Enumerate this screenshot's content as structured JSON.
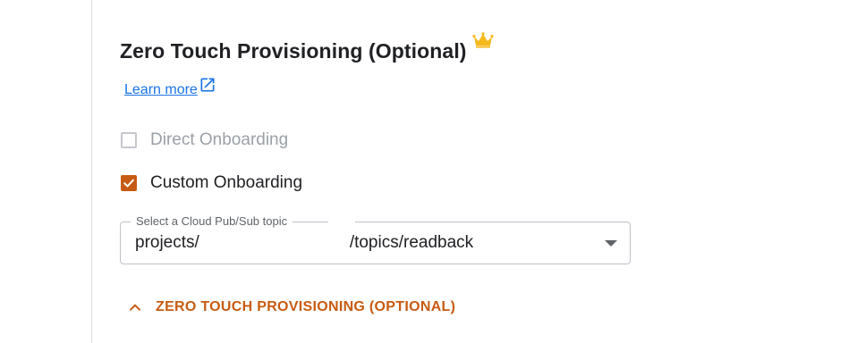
{
  "section": {
    "title": "Zero Touch Provisioning (Optional)",
    "premium_icon": "crown-icon",
    "learn_more_label": "Learn more",
    "learn_more_icon": "external-link-icon"
  },
  "options": [
    {
      "label": "Direct Onboarding",
      "checked": false,
      "disabled": true
    },
    {
      "label": "Custom Onboarding",
      "checked": true,
      "disabled": false
    }
  ],
  "pubsub_select": {
    "label": "Select a Cloud Pub/Sub topic",
    "value_prefix": "projects/",
    "value_suffix": "/topics/readback",
    "dropdown_icon": "dropdown-arrow-icon"
  },
  "collapse_toggle": {
    "label": "ZERO TOUCH PROVISIONING (OPTIONAL)",
    "icon": "chevron-up-icon"
  },
  "colors": {
    "accent": "#c75b12",
    "link": "#1a73e8",
    "crown": "#f6b91c",
    "text_primary": "#202124",
    "text_disabled": "#9aa0a6",
    "border": "#bdc1c6"
  }
}
